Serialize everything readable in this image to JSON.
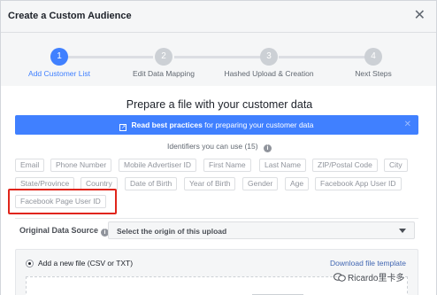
{
  "dialog": {
    "title": "Create a Custom Audience"
  },
  "steps": [
    {
      "number": "1",
      "label": "Add Customer List"
    },
    {
      "number": "2",
      "label": "Edit Data Mapping"
    },
    {
      "number": "3",
      "label": "Hashed Upload & Creation"
    },
    {
      "number": "4",
      "label": "Next Steps"
    }
  ],
  "prepare": {
    "title": "Prepare a file with your customer data",
    "best_practices_bold": "Read best practices",
    "best_practices_rest": " for preparing your customer data"
  },
  "identifiers": {
    "label": "Identifiers you can use",
    "count": "(15)",
    "tags": [
      "Email",
      "Phone Number",
      "Mobile Advertiser ID",
      "First Name",
      "Last Name",
      "ZIP/Postal Code",
      "City",
      "State/Province",
      "Country",
      "Date of Birth",
      "Year of Birth",
      "Gender",
      "Age",
      "Facebook App User ID",
      "Facebook Page User ID"
    ]
  },
  "origin": {
    "label": "Original Data Source",
    "placeholder": "Select the origin of this upload"
  },
  "upload": {
    "option_label": "Add a new file (CSV or TXT)",
    "download_link": "Download file template"
  },
  "watermark": {
    "text": "Ricardo里卡多"
  },
  "colors": {
    "accent": "#4080ff",
    "highlight": "#e0251b",
    "link": "#4267b2"
  }
}
